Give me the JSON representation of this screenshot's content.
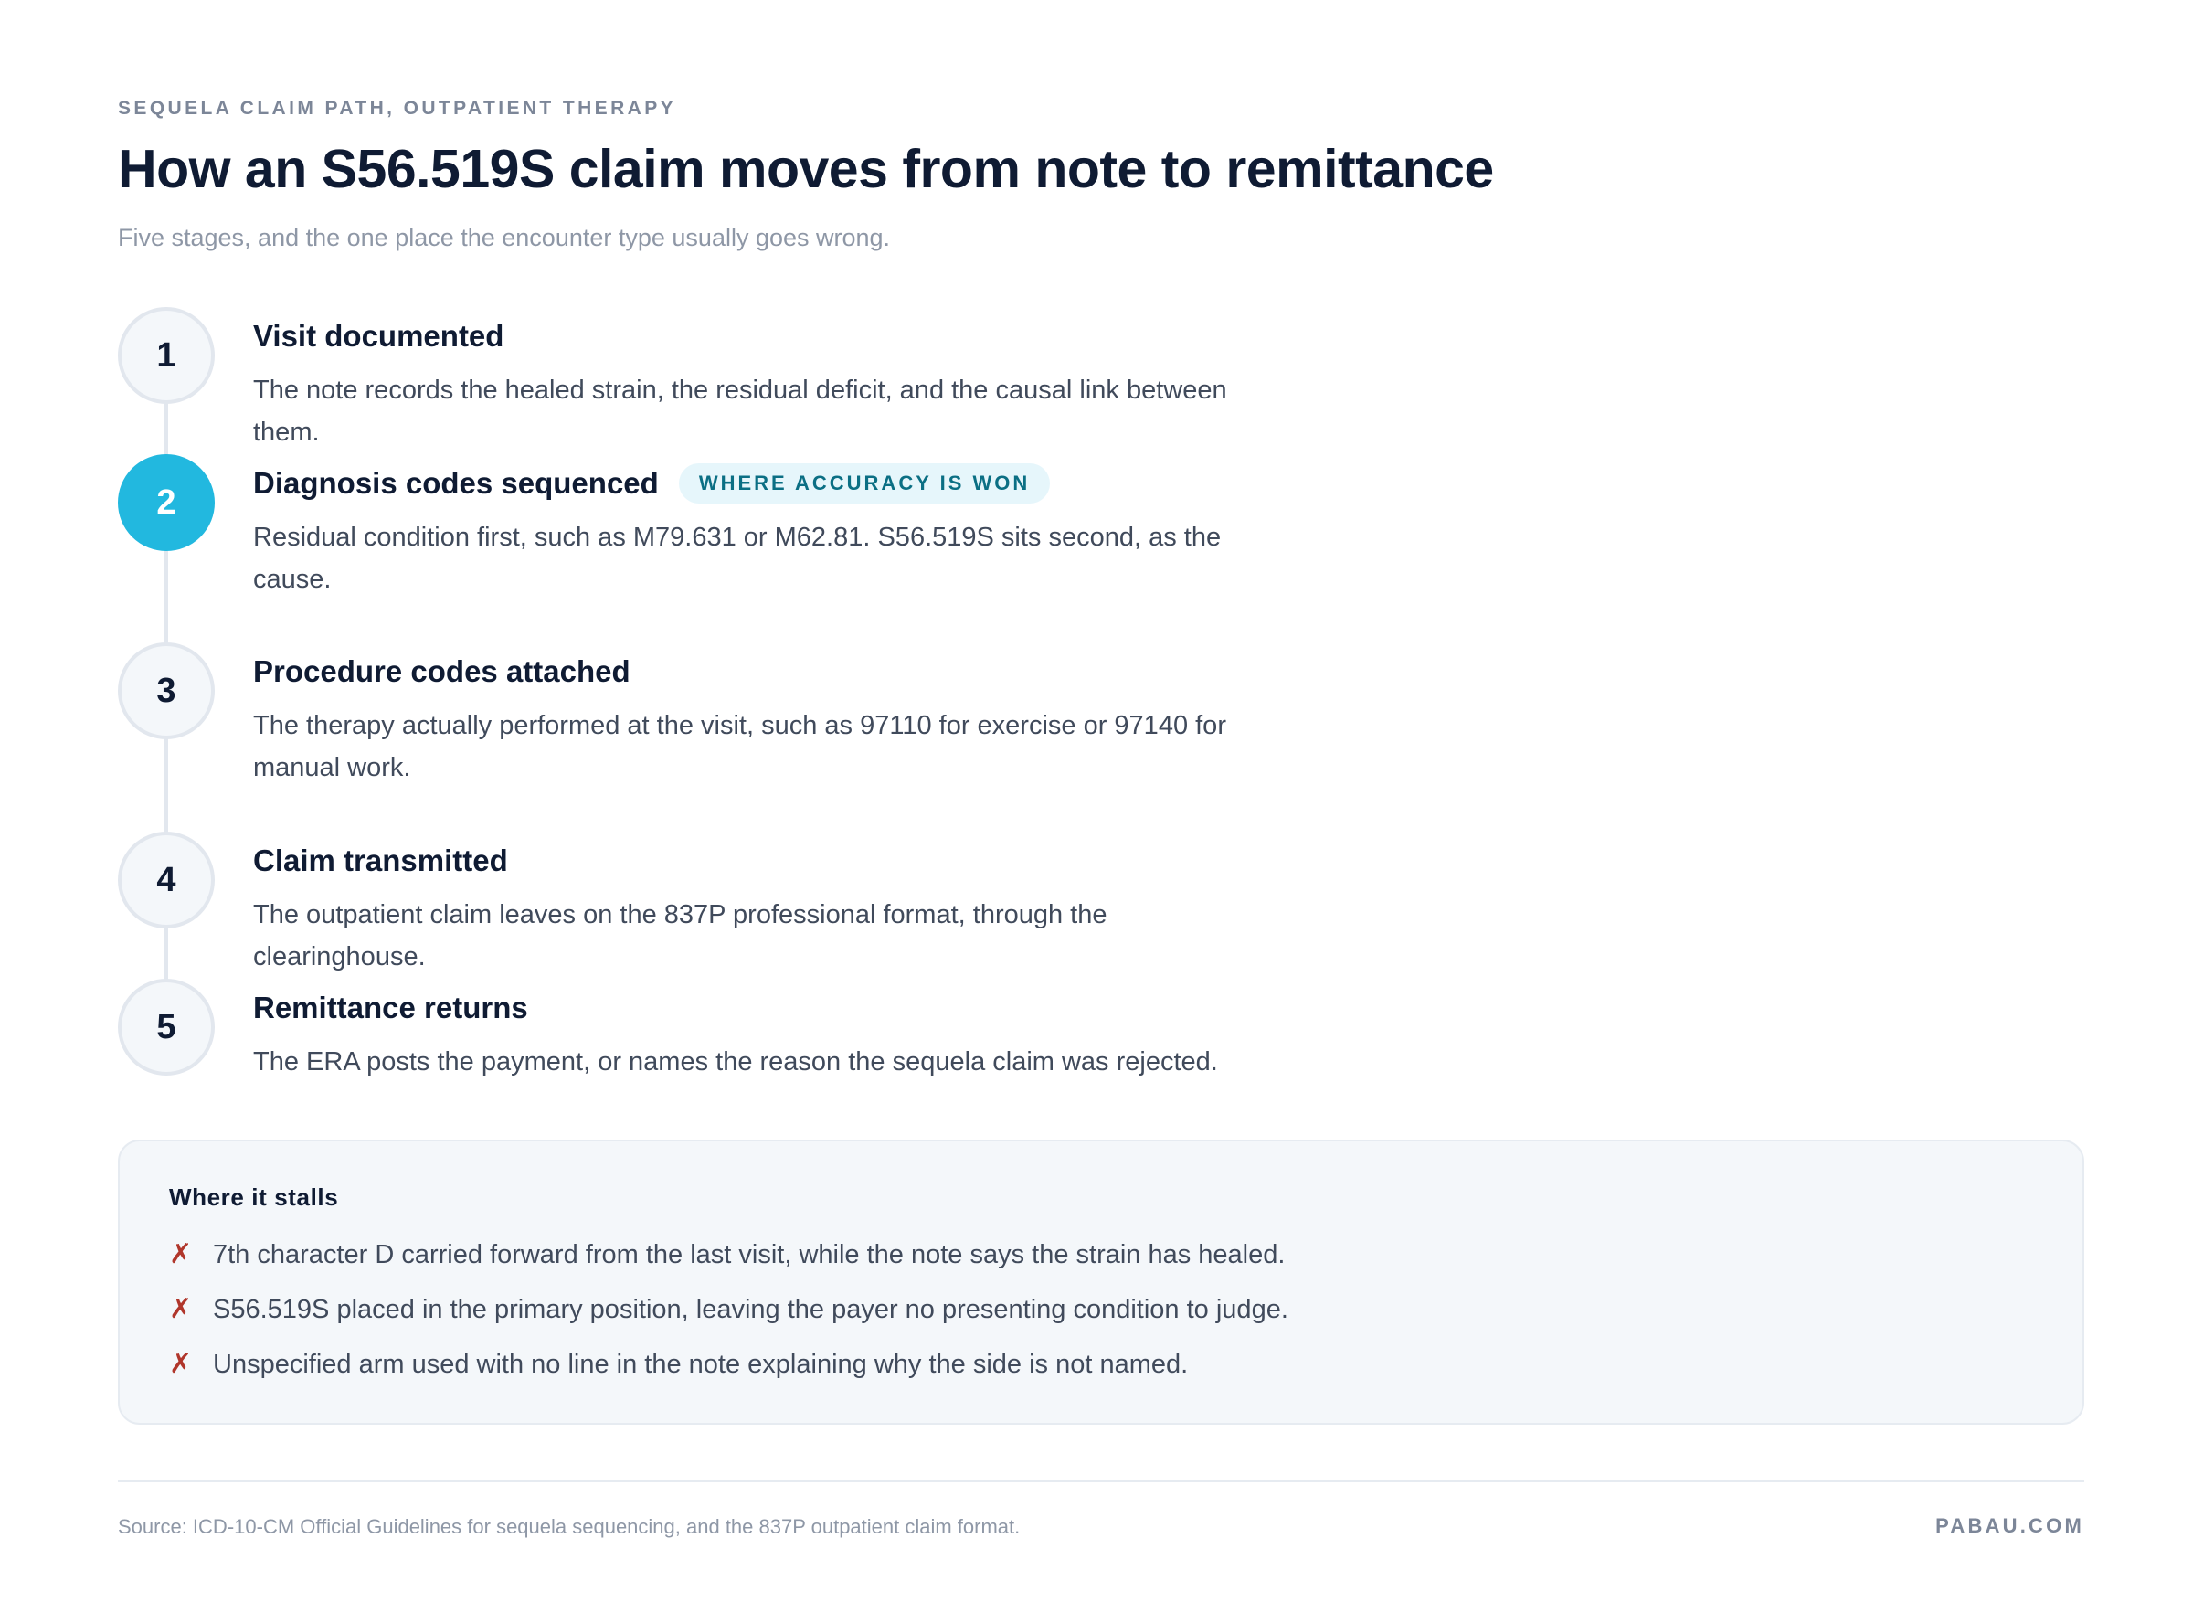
{
  "header": {
    "eyebrow": "SEQUELA CLAIM PATH, OUTPATIENT THERAPY",
    "title": "How an S56.519S claim moves from note to remittance",
    "subtitle": "Five stages, and the one place the encounter type usually goes wrong."
  },
  "steps": [
    {
      "number": "1",
      "title": "Visit documented",
      "description": "The note records the healed strain, the residual deficit, and the causal link between them."
    },
    {
      "number": "2",
      "title": "Diagnosis codes sequenced",
      "badge": "WHERE ACCURACY IS WON",
      "description": "Residual condition first, such as M79.631 or M62.81. S56.519S sits second, as the cause."
    },
    {
      "number": "3",
      "title": "Procedure codes attached",
      "description": "The therapy actually performed at the visit, such as 97110 for exercise or 97140 for manual work."
    },
    {
      "number": "4",
      "title": "Claim transmitted",
      "description": "The outpatient claim leaves on the 837P professional format, through the clearinghouse."
    },
    {
      "number": "5",
      "title": "Remittance returns",
      "description": "The ERA posts the payment, or names the reason the sequela claim was rejected."
    }
  ],
  "stalls": {
    "title": "Where it stalls",
    "icon": "cross-icon",
    "icon_glyph": "✗",
    "items": [
      "7th character D carried forward from the last visit, while the note says the strain has healed.",
      "S56.519S placed in the primary position, leaving the payer no presenting condition to judge.",
      "Unspecified arm used with no line in the note explaining why the side is not named."
    ]
  },
  "footer": {
    "source": "Source: ICD-10-CM Official Guidelines for sequela sequencing, and the 837P outpatient claim format.",
    "brand": "PABAU.COM"
  },
  "colors": {
    "accent": "#22b8df",
    "badge_bg": "#e6f6fb",
    "badge_text": "#0b6f84",
    "cross": "#b0362b",
    "ink": "#0f1b33"
  }
}
